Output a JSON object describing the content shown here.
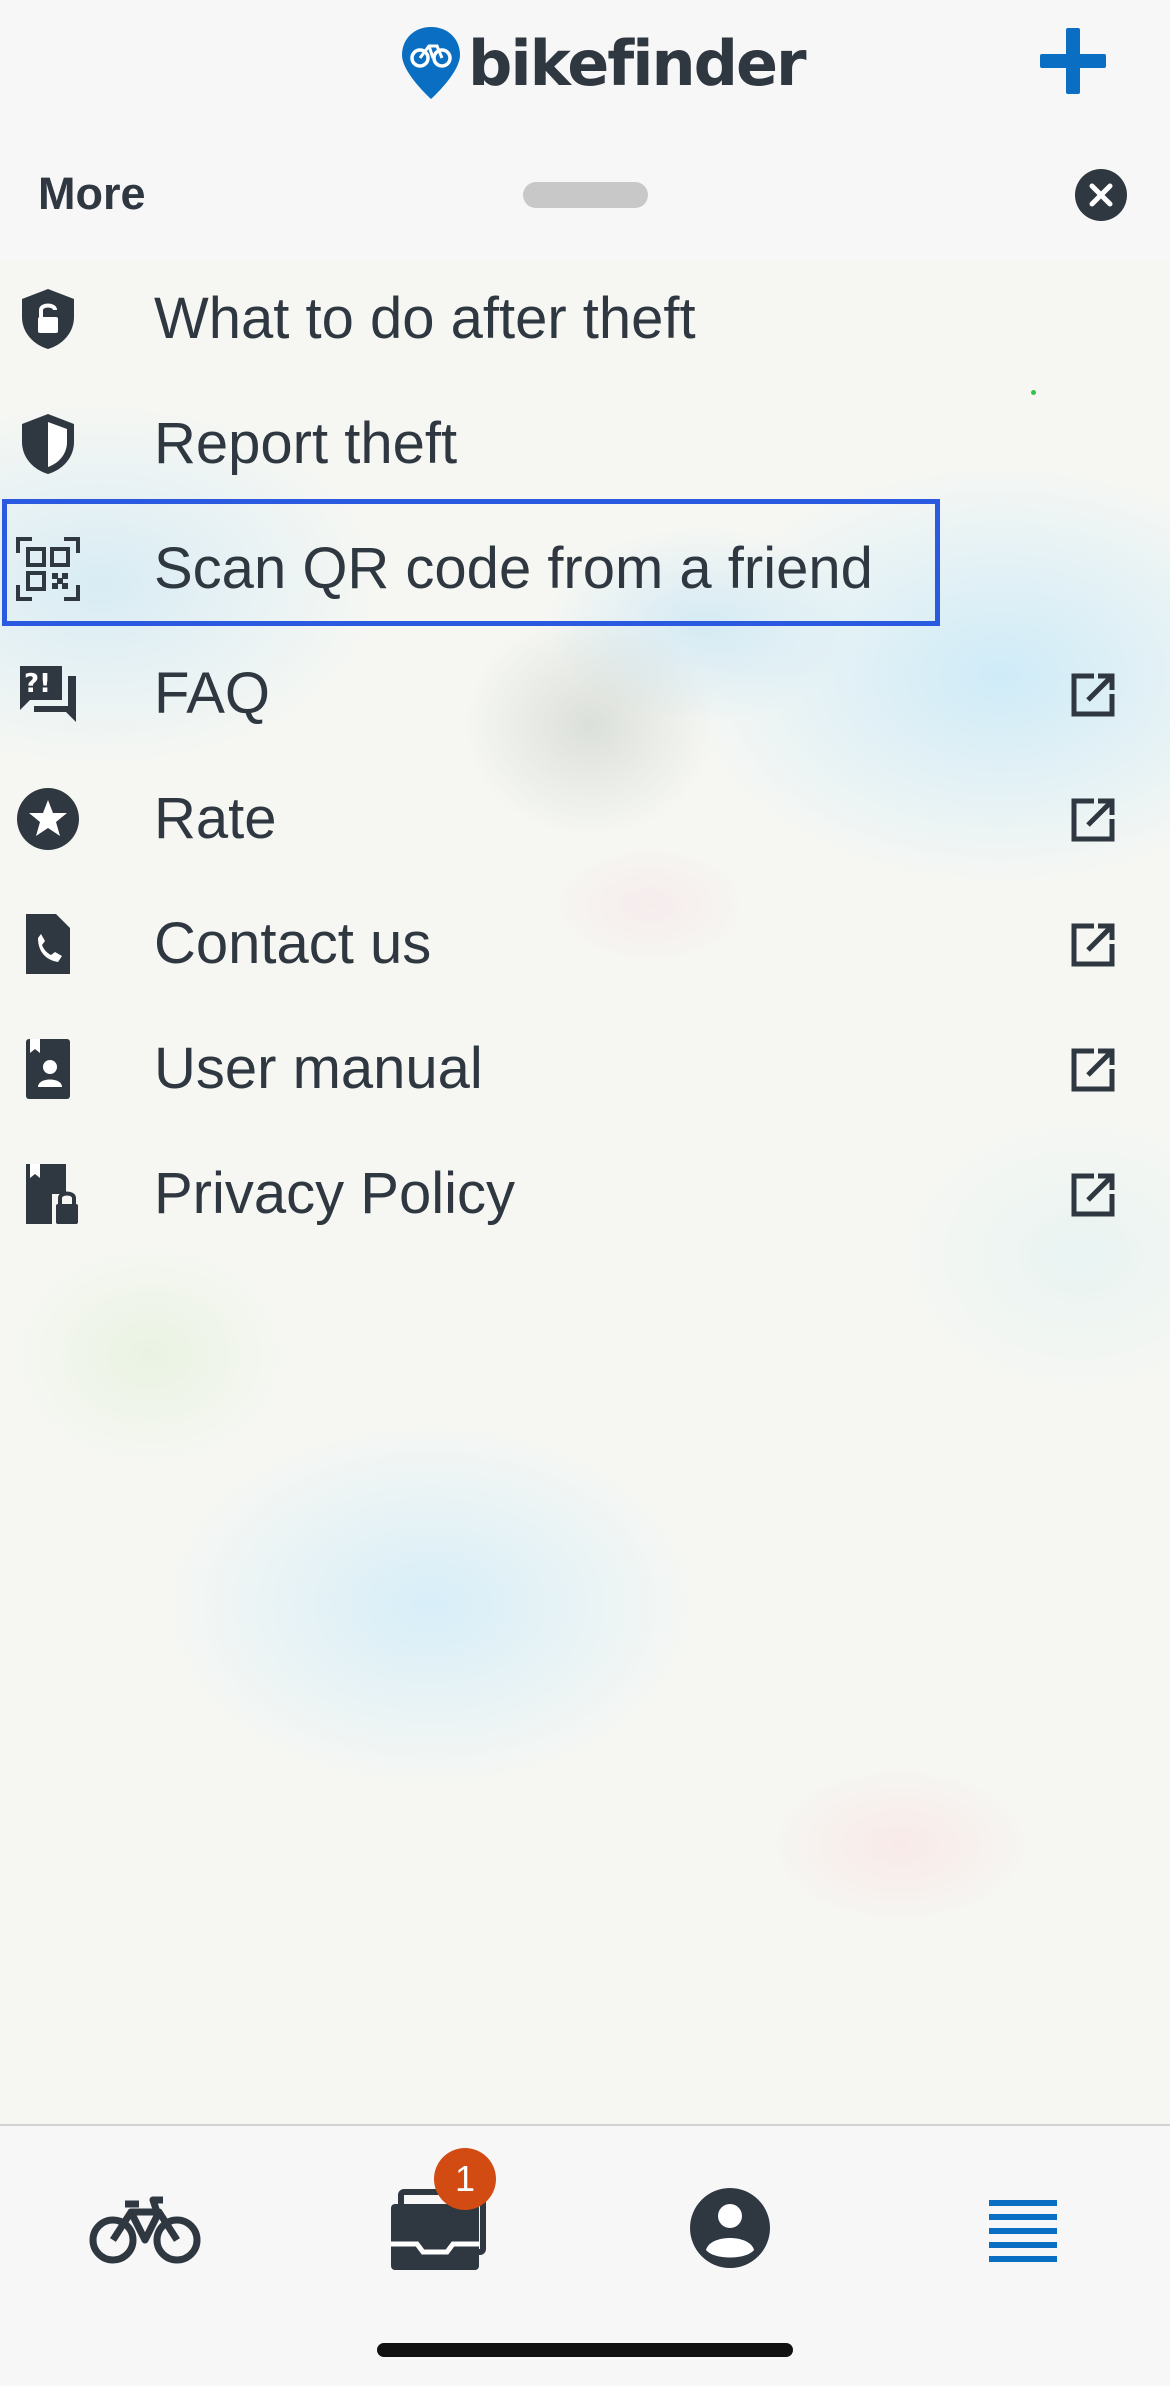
{
  "app": {
    "logo_text": "bikefinder",
    "accent_color": "#0a6fc2",
    "add_icon": "plus-icon"
  },
  "sheet": {
    "title": "More",
    "close_icon": "close-circle-icon"
  },
  "menu": {
    "items": [
      {
        "label": "What to do after theft",
        "icon": "shield-unlock-icon",
        "external": false
      },
      {
        "label": "Report theft",
        "icon": "shield-half-icon",
        "external": false
      },
      {
        "label": "Scan QR code from a friend",
        "icon": "qr-scan-icon",
        "external": false,
        "highlighted": true
      },
      {
        "label": "FAQ",
        "icon": "question-chat-icon",
        "external": true
      },
      {
        "label": "Rate",
        "icon": "star-circle-icon",
        "external": true
      },
      {
        "label": "Contact us",
        "icon": "phone-document-icon",
        "external": true
      },
      {
        "label": "User manual",
        "icon": "user-book-icon",
        "external": true
      },
      {
        "label": "Privacy Policy",
        "icon": "lock-book-icon",
        "external": true
      }
    ],
    "external_icon": "open-external-icon",
    "highlight_color": "#2a5ae0"
  },
  "tabbar": {
    "tabs": [
      {
        "icon": "bicycle-icon",
        "active": false
      },
      {
        "icon": "inbox-icon",
        "active": false,
        "badge": "1"
      },
      {
        "icon": "account-icon",
        "active": false
      },
      {
        "icon": "menu-icon",
        "active": true
      }
    ],
    "badge_color": "#d24b12",
    "active_color": "#0a6fc2"
  }
}
